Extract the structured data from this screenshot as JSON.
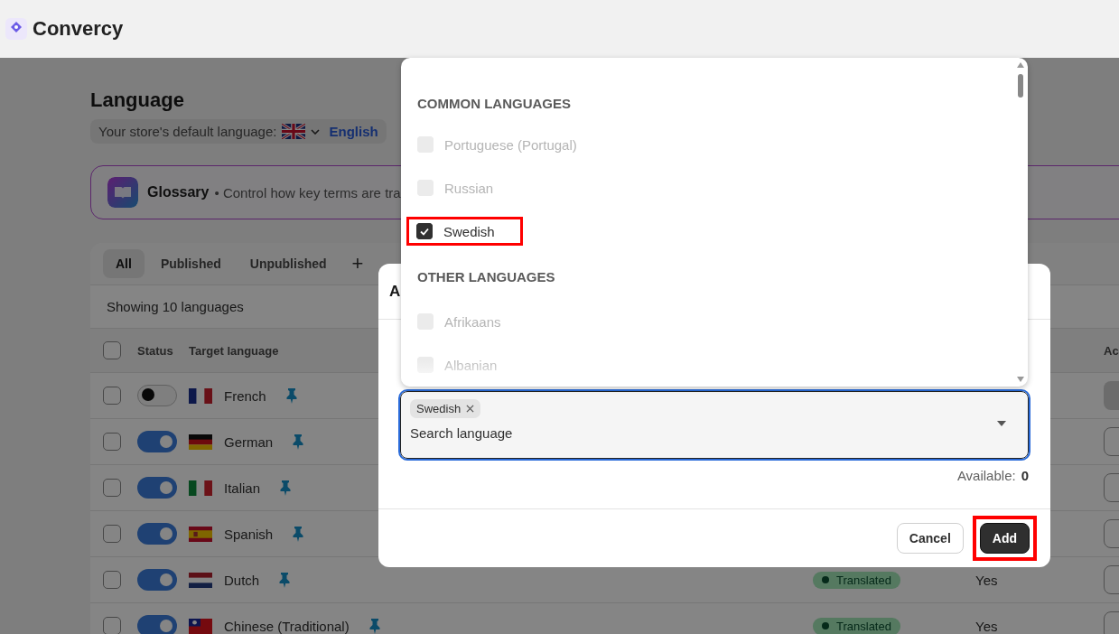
{
  "app": {
    "name": "Convercy"
  },
  "page": {
    "title": "Language",
    "default_language": {
      "label": "Your store's default language:",
      "kind": "gb",
      "value": "English"
    },
    "glossary": {
      "title": "Glossary",
      "text": "• Control how key terms are tra"
    },
    "tabs": [
      {
        "label": "All",
        "selected": true
      },
      {
        "label": "Published",
        "selected": false
      },
      {
        "label": "Unpublished",
        "selected": false
      }
    ],
    "add_tab": "+",
    "count": "Showing 10 languages",
    "table": {
      "columns": [
        "Status",
        "Target language",
        "Ac"
      ],
      "all_checked": false,
      "rows": [
        {
          "name": "French",
          "kind": "fr",
          "checked": false,
          "published": false,
          "action_disabled": true
        },
        {
          "name": "German",
          "kind": "de",
          "checked": false,
          "published": true,
          "action_disabled": false
        },
        {
          "name": "Italian",
          "kind": "it",
          "checked": false,
          "published": true,
          "action_disabled": false
        },
        {
          "name": "Spanish",
          "kind": "es",
          "checked": false,
          "published": true,
          "action_disabled": false
        },
        {
          "name": "Dutch",
          "kind": "nl",
          "checked": false,
          "published": true,
          "status": "Translated",
          "column_4": "Yes",
          "action_disabled": false
        },
        {
          "name": "Chinese (Traditional)",
          "kind": "tw",
          "checked": false,
          "published": true,
          "status": "Translated",
          "column_4": "Yes",
          "action_disabled": false
        }
      ]
    }
  },
  "modal": {
    "title": "A",
    "field": {
      "chips": [
        "Swedish"
      ],
      "placeholder": "Search language"
    },
    "available": {
      "label": "Available:",
      "value": "0"
    },
    "buttons": [
      {
        "label": "Cancel",
        "kind": "secondary",
        "highlighted": false
      },
      {
        "label": "Add",
        "kind": "primary",
        "highlighted": true
      }
    ]
  },
  "dropdown": {
    "groups": [
      {
        "heading": "COMMON LANGUAGES",
        "options": [
          {
            "label": "Portuguese (Portugal)",
            "checked": false,
            "disabled": true,
            "highlighted": false
          },
          {
            "label": "Russian",
            "checked": false,
            "disabled": true,
            "highlighted": false
          },
          {
            "label": "Swedish",
            "checked": true,
            "disabled": false,
            "highlighted": true
          }
        ]
      },
      {
        "heading": "OTHER LANGUAGES",
        "options": [
          {
            "label": "Afrikaans",
            "checked": false,
            "disabled": true,
            "highlighted": false
          },
          {
            "label": "Albanian",
            "checked": false,
            "disabled": true,
            "highlighted": false
          }
        ]
      }
    ]
  }
}
